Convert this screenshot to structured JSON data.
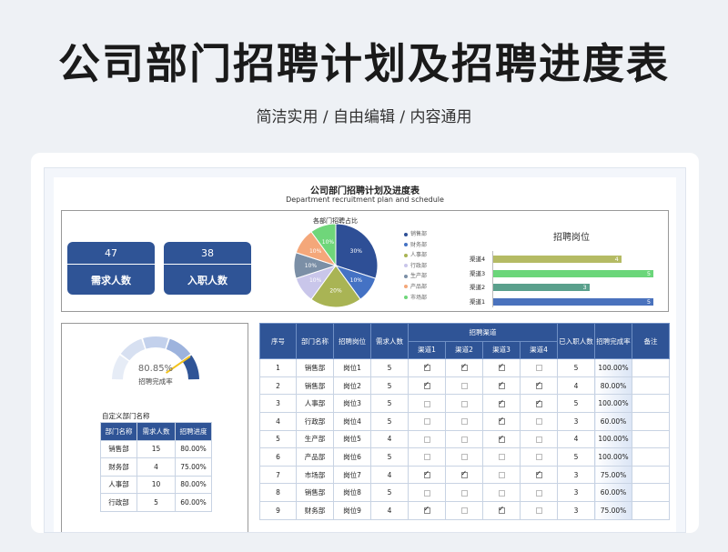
{
  "header": {
    "title": "公司部门招聘计划及招聘进度表",
    "subtitle": "简洁实用 / 自由编辑 / 内容通用"
  },
  "doc": {
    "title": "公司部门招聘计划及进度表",
    "subtitle": "Department recruitment plan and schedule"
  },
  "kpis": [
    {
      "value": "47",
      "label": "需求人数"
    },
    {
      "value": "38",
      "label": "入职人数"
    }
  ],
  "chart_data": [
    {
      "type": "pie",
      "title": "各部门招聘占比",
      "categories": [
        "销售部",
        "财务部",
        "人事部",
        "行政部",
        "生产部",
        "产品部",
        "市场部"
      ],
      "values": [
        30,
        10,
        20,
        10,
        10,
        10,
        10
      ],
      "labels": [
        "30%",
        "10%",
        "20%",
        "10%",
        "10%",
        "10%",
        "10%"
      ],
      "colors": [
        "#2e4f96",
        "#4472c4",
        "#a9b454",
        "#c9c6ea",
        "#7b8fa6",
        "#f4a77a",
        "#6fd67a"
      ]
    },
    {
      "type": "bar",
      "title": "招聘岗位",
      "categories": [
        "渠道4",
        "渠道3",
        "渠道2",
        "渠道1"
      ],
      "values": [
        4,
        5,
        3,
        5
      ],
      "colors": [
        "#b5bb64",
        "#6bd67a",
        "#5aa08c",
        "#4a72bd"
      ],
      "orientation": "horizontal"
    },
    {
      "type": "gauge",
      "value": 80.85,
      "display": "80.85%",
      "label": "招聘完成率"
    }
  ],
  "left_table": {
    "caption": "自定义部门名称",
    "headers": [
      "部门名称",
      "需求人数",
      "招聘进度"
    ],
    "rows": [
      [
        "销售部",
        "15",
        "80.00%"
      ],
      [
        "财务部",
        "4",
        "75.00%"
      ],
      [
        "人事部",
        "10",
        "80.00%"
      ],
      [
        "行政部",
        "5",
        "60.00%"
      ]
    ]
  },
  "main_table": {
    "headers": [
      "序号",
      "部门名称",
      "招聘岗位",
      "需求人数",
      "招聘渠道",
      "已入职人数",
      "招聘完成率",
      "备注"
    ],
    "channels": [
      "渠道1",
      "渠道2",
      "渠道3",
      "渠道4"
    ],
    "rows": [
      {
        "no": "1",
        "dept": "销售部",
        "pos": "岗位1",
        "need": "5",
        "ch": [
          1,
          1,
          1,
          0
        ],
        "hired": "5",
        "rate": "100.00%"
      },
      {
        "no": "2",
        "dept": "销售部",
        "pos": "岗位2",
        "need": "5",
        "ch": [
          1,
          0,
          1,
          1
        ],
        "hired": "4",
        "rate": "80.00%"
      },
      {
        "no": "3",
        "dept": "人事部",
        "pos": "岗位3",
        "need": "5",
        "ch": [
          0,
          0,
          1,
          1
        ],
        "hired": "5",
        "rate": "100.00%"
      },
      {
        "no": "4",
        "dept": "行政部",
        "pos": "岗位4",
        "need": "5",
        "ch": [
          0,
          0,
          1,
          0
        ],
        "hired": "3",
        "rate": "60.00%"
      },
      {
        "no": "5",
        "dept": "生产部",
        "pos": "岗位5",
        "need": "4",
        "ch": [
          0,
          0,
          1,
          0
        ],
        "hired": "4",
        "rate": "100.00%"
      },
      {
        "no": "6",
        "dept": "产品部",
        "pos": "岗位6",
        "need": "5",
        "ch": [
          0,
          0,
          0,
          0
        ],
        "hired": "5",
        "rate": "100.00%"
      },
      {
        "no": "7",
        "dept": "市场部",
        "pos": "岗位7",
        "need": "4",
        "ch": [
          1,
          1,
          0,
          1
        ],
        "hired": "3",
        "rate": "75.00%"
      },
      {
        "no": "8",
        "dept": "销售部",
        "pos": "岗位8",
        "need": "5",
        "ch": [
          0,
          0,
          0,
          0
        ],
        "hired": "3",
        "rate": "60.00%"
      },
      {
        "no": "9",
        "dept": "财务部",
        "pos": "岗位9",
        "need": "4",
        "ch": [
          1,
          0,
          1,
          0
        ],
        "hired": "3",
        "rate": "75.00%"
      }
    ]
  }
}
